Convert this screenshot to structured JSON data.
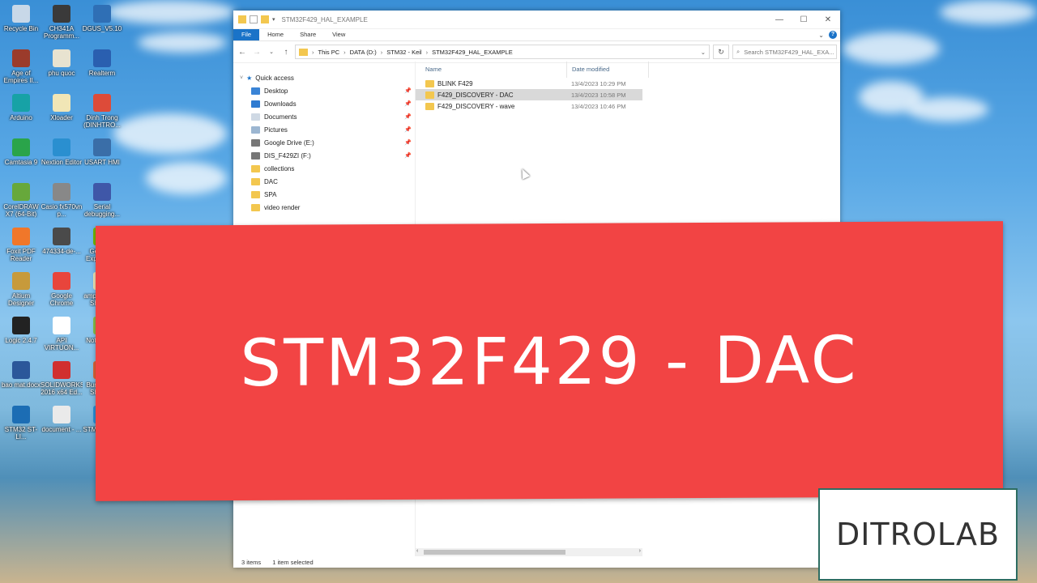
{
  "desktop": {
    "icons": [
      {
        "label": "Recycle Bin",
        "color": "#c8d8e8"
      },
      {
        "label": "CH341A Programm...",
        "color": "#3a3a3a"
      },
      {
        "label": "DGUS_V5.10",
        "color": "#2f6fb5"
      },
      {
        "label": "Age of Empires II...",
        "color": "#9b3b2b"
      },
      {
        "label": "phu quoc",
        "color": "#e8e3d0"
      },
      {
        "label": "Realterm",
        "color": "#2a5fb0"
      },
      {
        "label": "Arduino",
        "color": "#17a2a6"
      },
      {
        "label": "Xloader",
        "color": "#f1e6b6"
      },
      {
        "label": "Dinh Trong (DINHTRO...",
        "color": "#dd4b39"
      },
      {
        "label": "Camtasia 9",
        "color": "#2aa44a"
      },
      {
        "label": "Nextion Editor",
        "color": "#2a8fd0"
      },
      {
        "label": "USART HMI",
        "color": "#3a6ea8"
      },
      {
        "label": "CorelDRAW X7 (64-Bit)",
        "color": "#67a83b"
      },
      {
        "label": "Casio fx570vn p...",
        "color": "#888888"
      },
      {
        "label": "Serial debugging...",
        "color": "#3f57a8"
      },
      {
        "label": "Foxit PDF Reader",
        "color": "#f0772a"
      },
      {
        "label": "474334-de-...",
        "color": "#4a4a4a"
      },
      {
        "label": "GeForce Experience",
        "color": "#76b900"
      },
      {
        "label": "Altium Designer",
        "color": "#c79a3b"
      },
      {
        "label": "Google Chrome",
        "color": "#e8453c"
      },
      {
        "label": "ampdisplay - Shortcut",
        "color": "#f1e6b6"
      },
      {
        "label": "Logic 2.4.7",
        "color": "#222222"
      },
      {
        "label": "API VIRTUON...",
        "color": "#ffffff"
      },
      {
        "label": "Notepad++",
        "color": "#8bbf4a"
      },
      {
        "label": "bao mat.docx",
        "color": "#2b579a"
      },
      {
        "label": "SOLIDWORKS 2016 x64 Ed...",
        "color": "#d12f2f"
      },
      {
        "label": "Burn-Lixe - Shortcut",
        "color": "#e0663a"
      },
      {
        "label": "STM32 ST-LI...",
        "color": "#1c6db4"
      },
      {
        "label": "document - ...",
        "color": "#eaeaea"
      },
      {
        "label": "STM32Cub...",
        "color": "#2d8fd6"
      }
    ]
  },
  "window": {
    "title": "STM32F429_HAL_EXAMPLE",
    "controls": {
      "minimize": "—",
      "maximize": "☐",
      "close": "✕"
    },
    "ribbon_tabs": [
      "File",
      "Home",
      "Share",
      "View"
    ],
    "help": "?",
    "breadcrumb": [
      "This PC",
      "DATA (D:)",
      "STM32 - Keil",
      "STM32F429_HAL_EXAMPLE"
    ],
    "search_placeholder": "Search STM32F429_HAL_EXA...",
    "nav": {
      "quick_access": "Quick access",
      "items": [
        {
          "label": "Desktop",
          "pinned": true,
          "color": "#3a84d6"
        },
        {
          "label": "Downloads",
          "pinned": true,
          "color": "#2f7bd1"
        },
        {
          "label": "Documents",
          "pinned": true,
          "color": "#cfd9e4"
        },
        {
          "label": "Pictures",
          "pinned": true,
          "color": "#9cb6d1"
        },
        {
          "label": "Google Drive (E:)",
          "pinned": true,
          "color": "#777777"
        },
        {
          "label": "DIS_F429ZI (F:)",
          "pinned": true,
          "color": "#777777"
        },
        {
          "label": "collections",
          "pinned": false,
          "color": "#f3c74f"
        },
        {
          "label": "DAC",
          "pinned": false,
          "color": "#f3c74f"
        },
        {
          "label": "SPA",
          "pinned": false,
          "color": "#f3c74f"
        },
        {
          "label": "video render",
          "pinned": false,
          "color": "#f3c74f"
        }
      ]
    },
    "columns": {
      "name": "Name",
      "date": "Date modified"
    },
    "files": [
      {
        "name": "BLINK F429",
        "date": "13/4/2023 10:29 PM",
        "selected": false
      },
      {
        "name": "F429_DISCOVERY - DAC",
        "date": "13/4/2023 10:58 PM",
        "selected": true
      },
      {
        "name": "F429_DISCOVERY - wave",
        "date": "13/4/2023 10:46 PM",
        "selected": false
      }
    ],
    "status": {
      "count": "3 items",
      "selected": "1 item selected"
    }
  },
  "banner": {
    "title": "STM32F429 - DAC",
    "color": "#f24444"
  },
  "logo": {
    "text": "DITROLAB"
  }
}
